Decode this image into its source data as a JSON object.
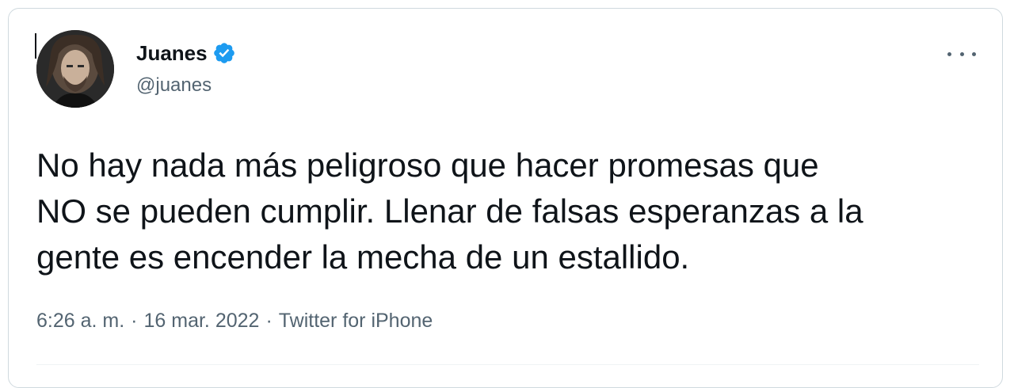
{
  "author": {
    "display_name": "Juanes",
    "handle": "@juanes",
    "verified": true,
    "verified_color": "#1d9bf0"
  },
  "tweet": {
    "text_lines": [
      "No hay nada más peligroso que hacer promesas que",
      "NO se pueden cumplir. Llenar de falsas esperanzas a la",
      "gente es encender la mecha de un estallido."
    ],
    "time": "6:26 a. m.",
    "date": "16 mar. 2022",
    "source": "Twitter for iPhone",
    "separator": "·"
  },
  "icons": {
    "more": "more-horizontal-icon",
    "verified": "verified-badge-icon",
    "avatar": "profile-avatar"
  }
}
